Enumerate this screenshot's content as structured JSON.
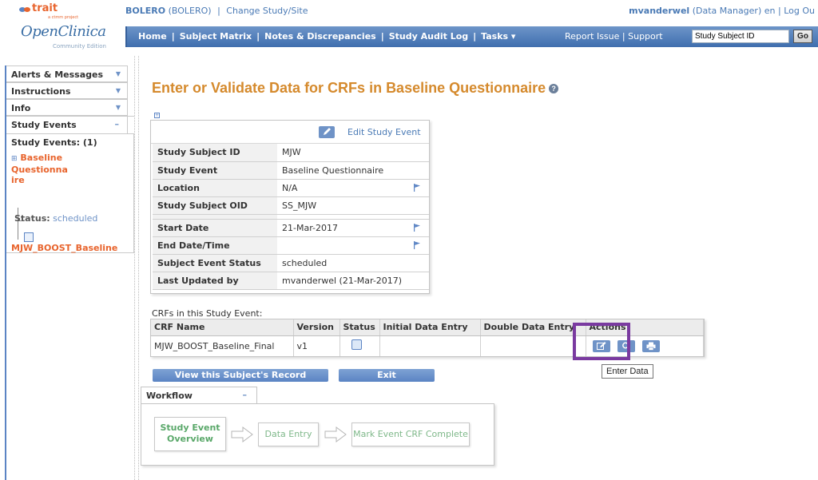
{
  "header": {
    "logo_trait": "trait",
    "logo_tagline": "a ctmm project",
    "logo_openclinica": "OpenClinica",
    "logo_edition": "Community Edition",
    "study_name": "BOLERO",
    "study_id": "(BOLERO)",
    "study_sep": "|",
    "change_study": "Change Study/Site",
    "user_name": "mvanderwel",
    "user_role": "(Data Manager)",
    "user_lang": "en",
    "user_sep": "|",
    "logout": "Log Ou"
  },
  "navbar": {
    "items": [
      "Home",
      "Subject Matrix",
      "Notes & Discrepancies",
      "Study Audit Log",
      "Tasks ▾"
    ],
    "sep": "|",
    "report_issue": "Report Issue",
    "support": "Support",
    "search_value": "Study Subject ID",
    "go_label": "Go"
  },
  "sidebar": {
    "tabs": [
      "Alerts & Messages",
      "Instructions",
      "Info"
    ],
    "study_events_label": "Study Events",
    "study_events_count": "Study Events: (1)",
    "event_name": "Baseline Questionna ire",
    "status_label": "Status:",
    "status_value": "scheduled",
    "crf_name": "MJW_BOOST_Baseline"
  },
  "main": {
    "title": "Enter or Validate Data for CRFs in Baseline Questionnaire",
    "edit_study_event": "Edit Study Event",
    "info_rows_top": [
      {
        "key": "Study Subject ID",
        "value": "MJW",
        "flag": false
      },
      {
        "key": "Study Event",
        "value": "Baseline Questionnaire",
        "flag": false
      },
      {
        "key": "Location",
        "value": "N/A",
        "flag": true
      },
      {
        "key": "Study Subject OID",
        "value": "SS_MJW",
        "flag": false
      }
    ],
    "info_rows_bottom": [
      {
        "key": "Start Date",
        "value": "21-Mar-2017",
        "flag": true
      },
      {
        "key": "End Date/Time",
        "value": "",
        "flag": true
      },
      {
        "key": "Subject Event Status",
        "value": "scheduled",
        "flag": false
      },
      {
        "key": "Last Updated by",
        "value": "mvanderwel (21-Mar-2017)",
        "flag": false
      }
    ],
    "crfs_label": "CRFs in this Study Event:",
    "crf_table": {
      "headers": [
        "CRF Name",
        "Version",
        "Status",
        "Initial Data Entry",
        "Double Data Entry",
        "Actions"
      ],
      "rows": [
        {
          "crf_name": "MJW_BOOST_Baseline_Final",
          "version": "v1",
          "initial": "",
          "double": ""
        }
      ]
    },
    "tooltip": "Enter Data",
    "view_record_button": "View this Subject's Record",
    "exit_button": "Exit"
  },
  "workflow": {
    "title": "Workflow",
    "steps": [
      "Study Event Overview",
      "Data Entry",
      "Mark Event CRF Complete"
    ]
  },
  "colors": {
    "accent_blue": "#4a7ab5",
    "title_orange": "#d58a2d",
    "highlight_purple": "#7a3aa0",
    "workflow_green": "#5aa86a"
  }
}
